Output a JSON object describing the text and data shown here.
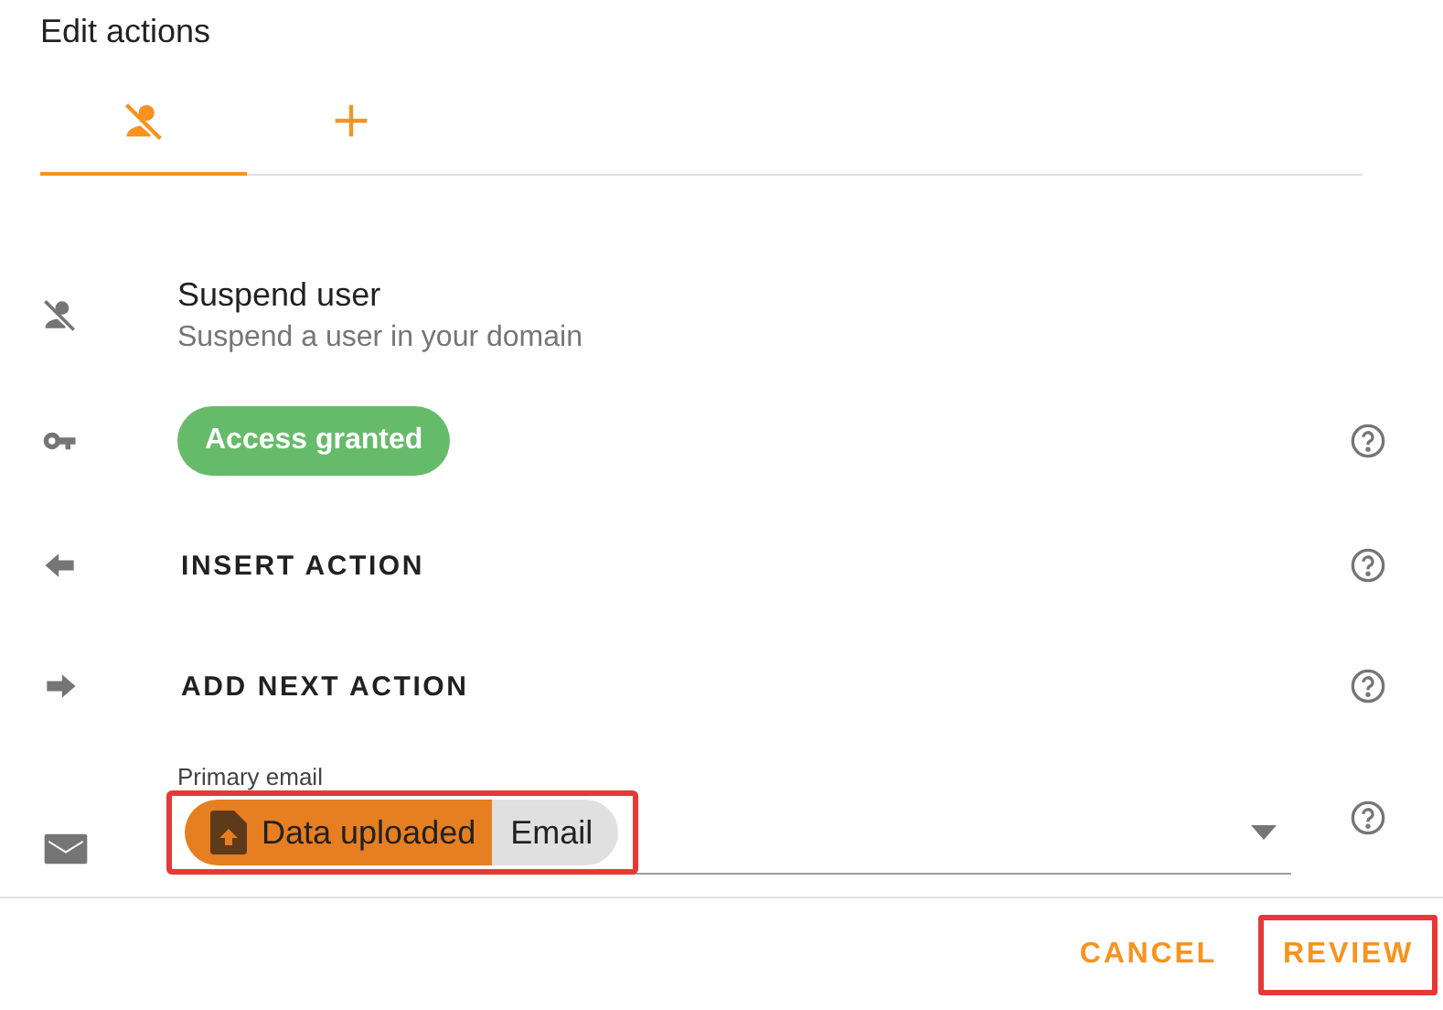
{
  "title": "Edit actions",
  "tabs": [
    {
      "selected": true
    },
    {
      "selected": false
    }
  ],
  "rows": [
    {
      "kind": "header",
      "title": "Suspend user",
      "subtitle": "Suspend a user in your domain"
    },
    {
      "kind": "badge",
      "label": "Access granted"
    },
    {
      "kind": "action",
      "label": "INSERT ACTION"
    },
    {
      "kind": "action",
      "label": "ADD NEXT ACTION"
    },
    {
      "kind": "select",
      "label": "Primary email",
      "chip": {
        "source": "Data uploaded",
        "field": "Email",
        "highlighted": true
      }
    }
  ],
  "buttons": [
    {
      "label": "CANCEL",
      "highlighted": false
    },
    {
      "label": "REVIEW",
      "highlighted": true
    }
  ]
}
